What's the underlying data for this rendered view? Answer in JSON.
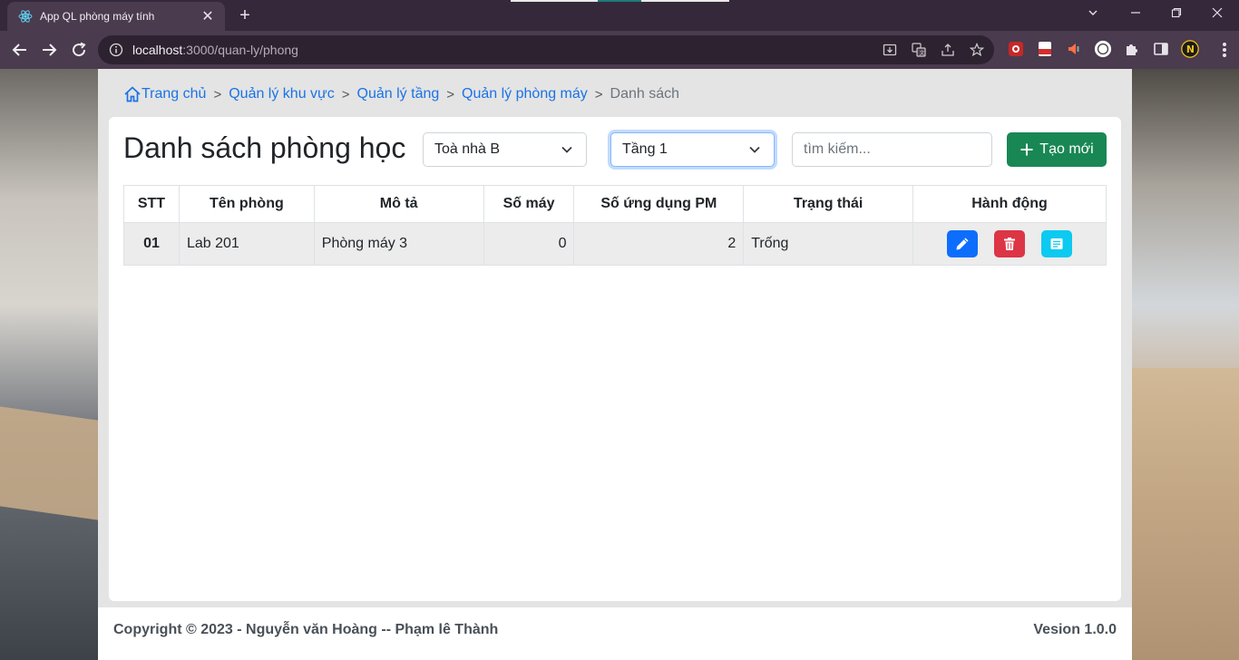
{
  "browser": {
    "tab_title": "App QL phòng máy tính",
    "url_host": "localhost",
    "url_path": ":3000/quan-ly/phong"
  },
  "breadcrumb": {
    "home": "Trang chủ",
    "area": "Quản lý khu vực",
    "floor": "Quản lý tầng",
    "room": "Quản lý phòng máy",
    "current": "Danh sách"
  },
  "main": {
    "title": "Danh sách phòng học",
    "building_select": "Toà nhà B",
    "floor_select": "Tầng 1",
    "search_placeholder": "tìm kiếm...",
    "create_label": "Tạo mới"
  },
  "table": {
    "headers": [
      "STT",
      "Tên phòng",
      "Mô tả",
      "Số máy",
      "Số ứng dụng PM",
      "Trạng thái",
      "Hành động"
    ],
    "rows": [
      [
        "01",
        "Lab 201",
        "Phòng máy 3",
        "0",
        "2",
        "Trống"
      ]
    ]
  },
  "footer": {
    "copyright": "Copyright © 2023 - Nguyễn văn Hoàng -- Phạm lê Thành",
    "version": "Vesion 1.0.0"
  },
  "colors": {
    "primary": "#0d6efd",
    "danger": "#dc3545",
    "info": "#0dcaf0",
    "success": "#198754",
    "link": "#1a73e8"
  },
  "icons": {
    "edit": "pencil-icon",
    "delete": "trash-icon",
    "detail": "message-icon",
    "home": "home-icon",
    "create": "plus-icon"
  }
}
